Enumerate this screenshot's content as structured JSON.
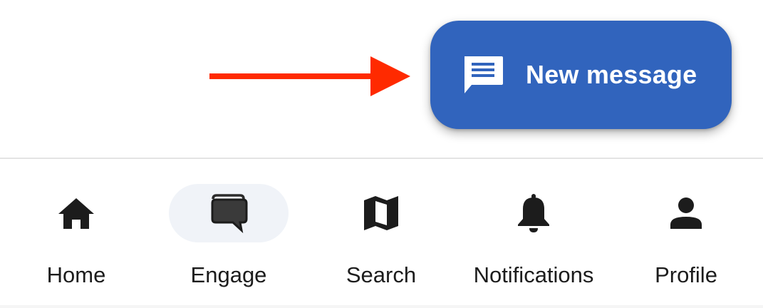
{
  "fab": {
    "label": "New message",
    "icon": "message-icon",
    "background_color": "#3164bd"
  },
  "annotation": {
    "icon": "red-arrow-icon",
    "color": "#ff2a00"
  },
  "bottom_nav": {
    "active_index": 1,
    "items": [
      {
        "label": "Home",
        "icon": "home-icon"
      },
      {
        "label": "Engage",
        "icon": "chat-bubbles-icon"
      },
      {
        "label": "Search",
        "icon": "map-icon"
      },
      {
        "label": "Notifications",
        "icon": "bell-icon"
      },
      {
        "label": "Profile",
        "icon": "person-icon"
      }
    ]
  }
}
